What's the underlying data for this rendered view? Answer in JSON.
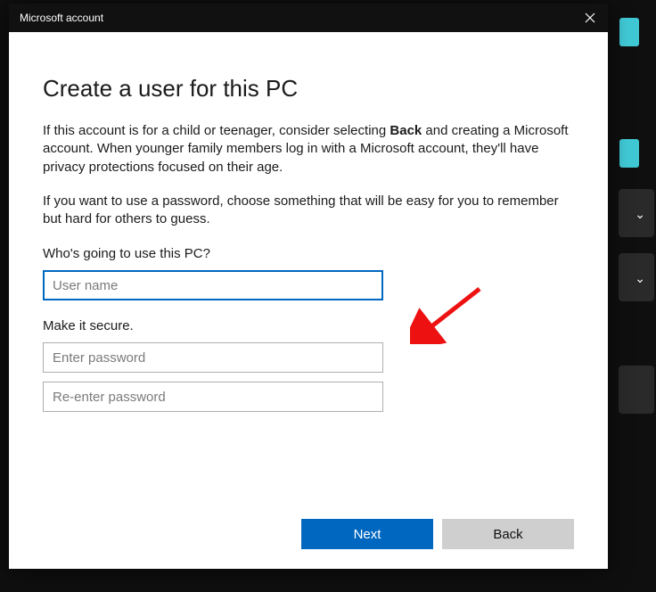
{
  "titlebar": {
    "title": "Microsoft account"
  },
  "page": {
    "heading": "Create a user for this PC",
    "para1_pre": "If this account is for a child or teenager, consider selecting ",
    "para1_bold": "Back",
    "para1_post": " and creating a Microsoft account. When younger family members log in with a Microsoft account, they'll have privacy protections focused on their age.",
    "para2": "If you want to use a password, choose something that will be easy for you to remember but hard for others to guess.",
    "user_label": "Who's going to use this PC?",
    "user_placeholder": "User name",
    "secure_label": "Make it secure.",
    "pw_placeholder": "Enter password",
    "pw2_placeholder": "Re-enter password"
  },
  "buttons": {
    "next": "Next",
    "back": "Back"
  }
}
